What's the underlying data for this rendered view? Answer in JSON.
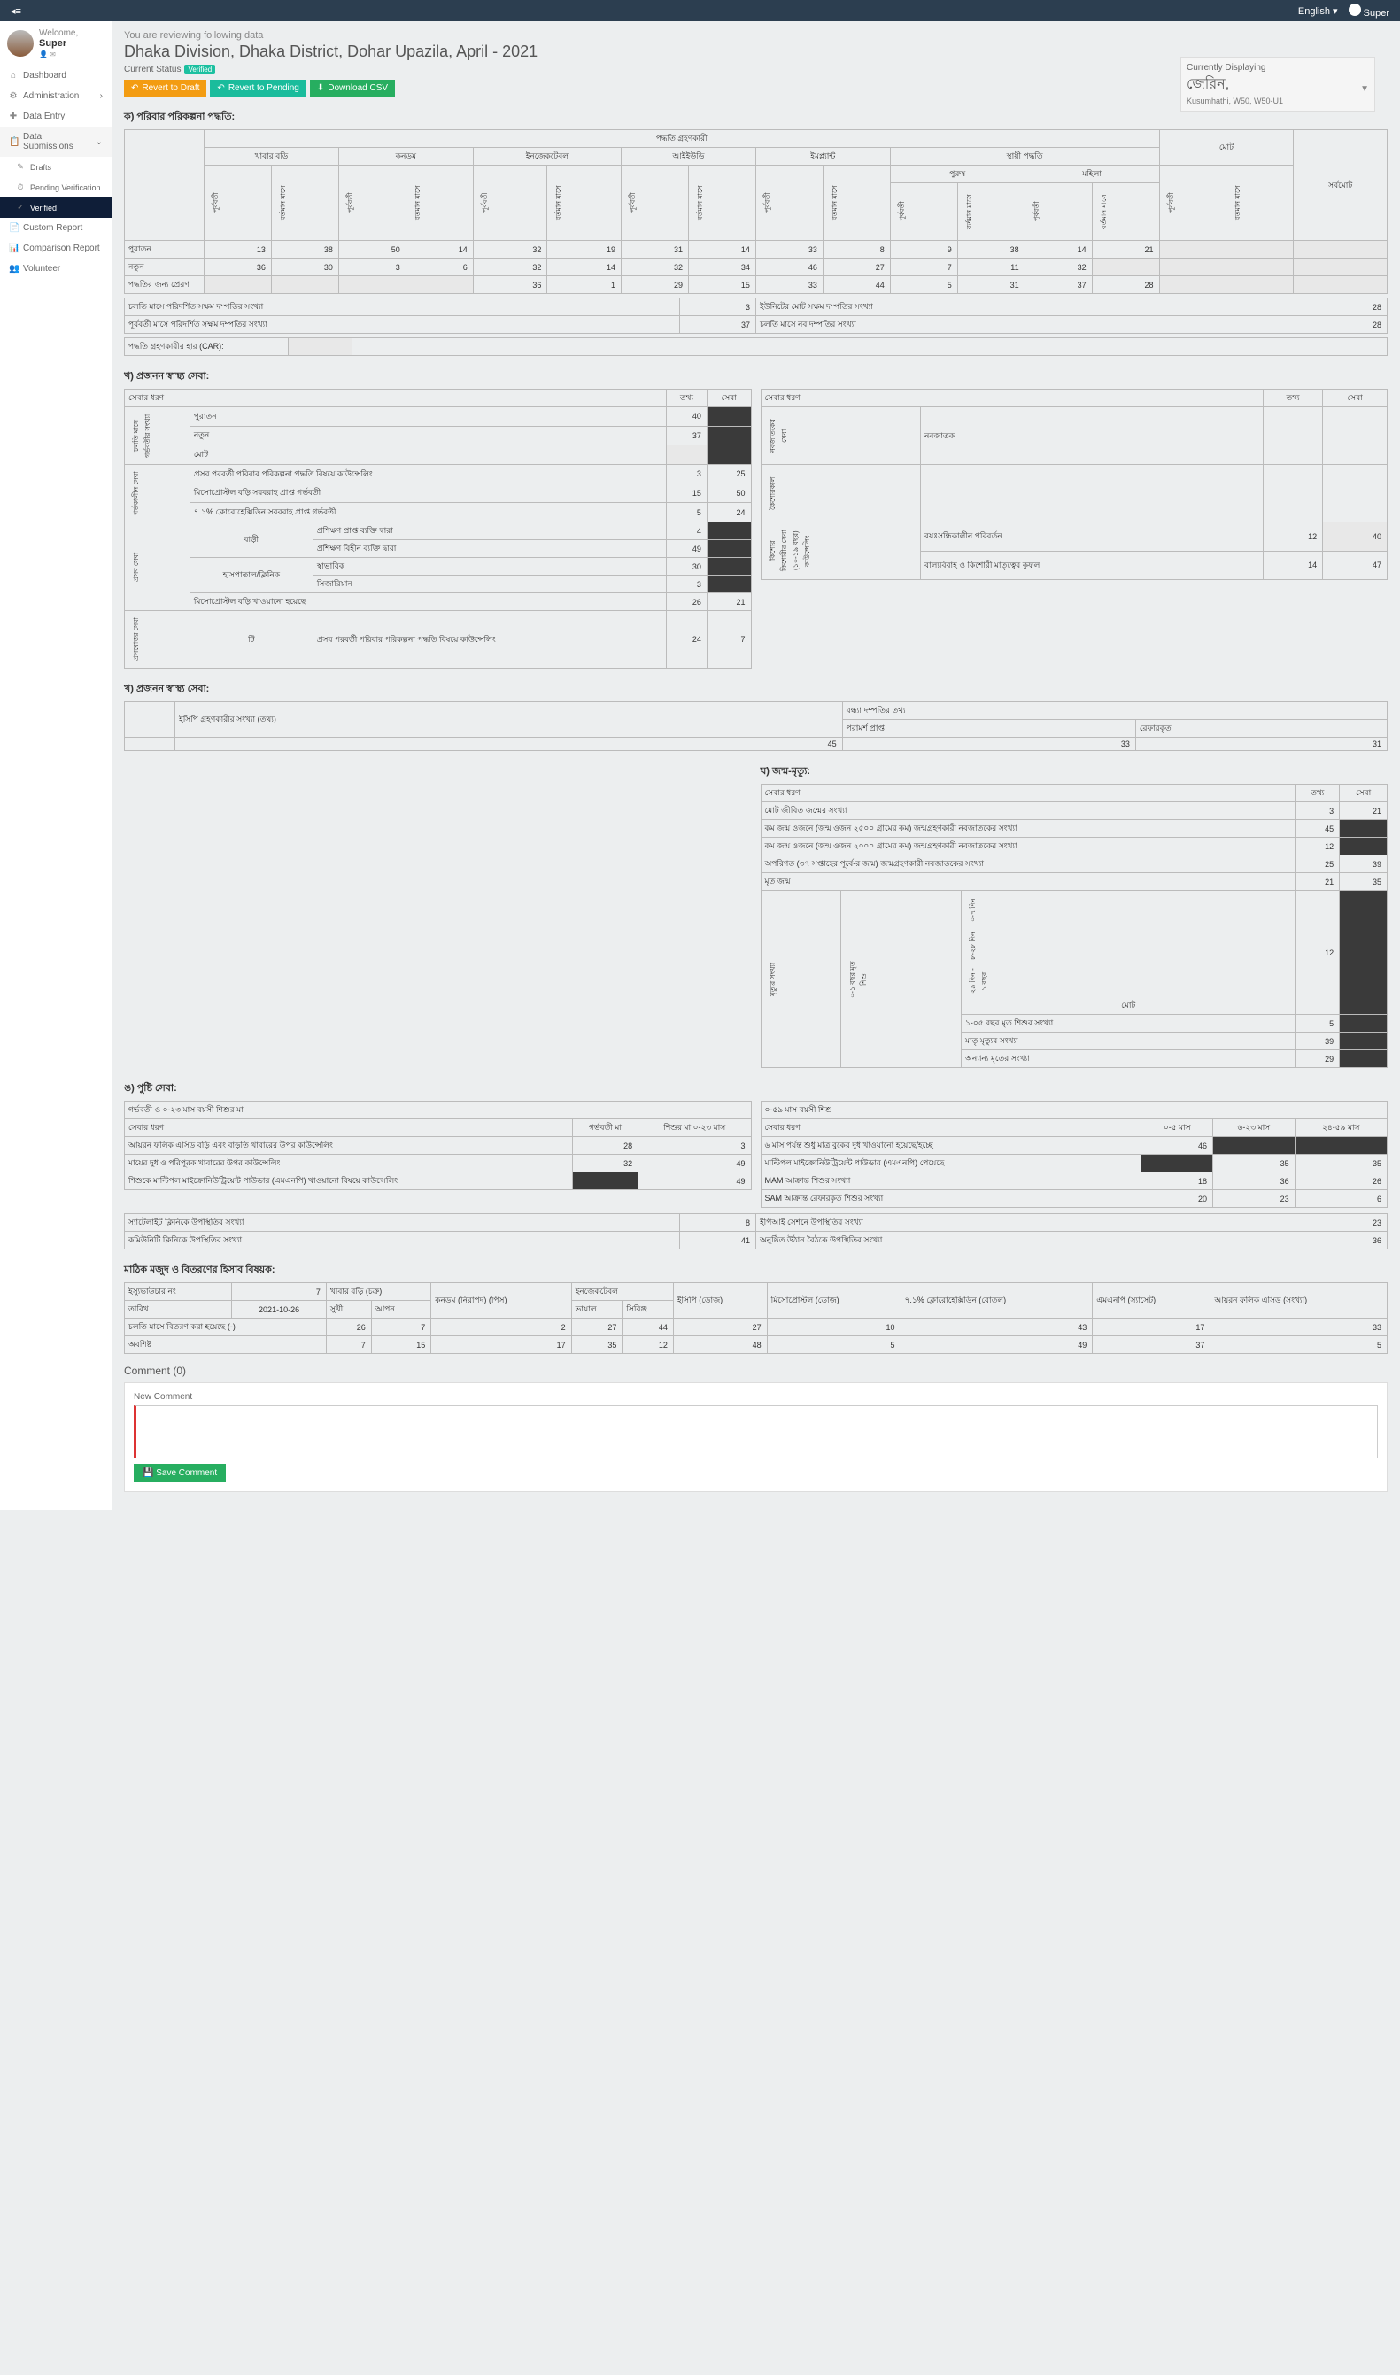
{
  "topbar": {
    "lang": "English",
    "user": "Super"
  },
  "user": {
    "welcome": "Welcome,",
    "name": "Super"
  },
  "nav": {
    "dashboard": "Dashboard",
    "admin": "Administration",
    "dataentry": "Data Entry",
    "datasub": "Data Submissions",
    "drafts": "Drafts",
    "pending": "Pending Verification",
    "verified": "Verified",
    "custom": "Custom Report",
    "compare": "Comparison Report",
    "volunteer": "Volunteer"
  },
  "head": {
    "review": "You are reviewing following data",
    "title": "Dhaka Division, Dhaka District, Dohar Upazila, April - 2021",
    "status_label": "Current Status",
    "status_badge": "Verified",
    "btn1": "Revert to Draft",
    "btn2": "Revert to Pending",
    "btn3": "Download CSV",
    "cd": "Currently Displaying",
    "cd_name": "জেরিন,",
    "cd_loc": "Kusumhathi, W50, W50-U1"
  },
  "secA": {
    "title": "ক) পরিবার পরিকল্পনা পদ্ধতি:",
    "top": "পদ্ধতি গ্রহণকারী",
    "h": {
      "pill": "খাবার বড়ি",
      "condom": "কনডম",
      "inj": "ইনজেকটেবল",
      "iud": "আইইউডি",
      "implant": "ইমপ্ল্যান্ট",
      "perm": "স্থায়ী পদ্ধতি",
      "male": "পুরুষ",
      "female": "মহিলা",
      "total": "মোট",
      "grand": "সর্বমোট",
      "prev": "পূর্ববর্তী",
      "curr": "বর্তমান মাসে",
      "left": "ছেড়ে দিয়ে..."
    },
    "rows": {
      "old": {
        "l": "পুরাতন",
        "v": [
          "13",
          "38",
          "50",
          "14",
          "32",
          "19",
          "31",
          "14",
          "33",
          "8",
          "9",
          "38",
          "14",
          "21",
          "",
          "",
          ""
        ]
      },
      "new": {
        "l": "নতুন",
        "v": [
          "36",
          "30",
          "3",
          "6",
          "32",
          "14",
          "32",
          "34",
          "46",
          "27",
          "7",
          "11",
          "32",
          "",
          "",
          ""
        ]
      },
      "send": {
        "l": "পদ্ধতির জন্য প্রেরণ",
        "v": [
          "",
          "",
          "",
          "",
          "36",
          "1",
          "29",
          "15",
          "33",
          "44",
          "5",
          "31",
          "37",
          "28",
          "",
          "",
          ""
        ]
      }
    },
    "foot": {
      "r1l": "চলতি মাসে পরিদর্শিত সক্ষম দম্পতির সংখ্যা",
      "r1v": "3",
      "r1l2": "ইউনিটের মোট সক্ষম দম্পতির সংখ্যা",
      "r1v2": "28",
      "r2l": "পূর্ববর্তী মাসে পরিদর্শিত সক্ষম দম্পতির সংখ্যা",
      "r2v": "37",
      "r2l2": "চলতি মাসে নব দম্পতির সংখ্যা",
      "r2v2": "28",
      "car": "পদ্ধতি গ্রহণকারীর হার (CAR):"
    }
  },
  "secB": {
    "title": "খ) প্রজনন স্বাস্থ্য সেবা:",
    "h": {
      "type": "সেবার ধরণ",
      "info": "তথ্য",
      "serv": "সেবা"
    },
    "left": {
      "group1": "চলতি মাসে গর্ভবতীর সংখ্যা",
      "old": "পুরাতন",
      "oldv": "40",
      "new": "নতুন",
      "newv": "37",
      "tot": "মোট",
      "group2": "গর্ভকালীন সেবা",
      "r1": "প্রসব পরবর্তী পরিবার পরিকল্পনা পদ্ধতি বিষয়ে কাউন্সেলিং",
      "r1a": "3",
      "r1b": "25",
      "r2": "মিসোপ্রোস্টল বড়ি সরবরাহ প্রাপ্ত গর্ভবতী",
      "r2a": "15",
      "r2b": "50",
      "r3": "৭.১% ক্লোরোহেক্সিডিন সরবরাহ প্রাপ্ত গর্ভবতী",
      "r3a": "5",
      "r3b": "24",
      "group3": "প্রসব সেবা",
      "home": "বাড়ী",
      "clinic": "হাসপাতাল/ক্লিনিক",
      "r4": "প্রশিক্ষণ প্রাপ্ত ব্যক্তি দ্বারা",
      "r4a": "4",
      "r5": "প্রশিক্ষণ বিহীন ব্যক্তি দ্বারা",
      "r5a": "49",
      "r6": "স্বাভাবিক",
      "r6a": "30",
      "r7": "সিজারিয়ান",
      "r7a": "3",
      "r8": "মিসোপ্রোস্টল বড়ি খাওয়ানো হয়েছে",
      "r8a": "26",
      "r8b": "21",
      "group4": "প্রসবোত্তর সেবা",
      "tick": "টি",
      "r9": "প্রসব পরবর্তী পরিবার পরিকল্পনা পদ্ধতি বিষয়ে কাউন্সেলিং",
      "r9a": "24",
      "r9b": "7"
    },
    "right": {
      "type": "সেবার ধরণ",
      "info": "তথ্য",
      "serv": "সেবা",
      "g1": "নবজাতকের সেবা",
      "g1r": "নবজাতক",
      "g2": "কৈশোরকাল",
      "g3": "কিশোর কিশোরীর সেবা (১০-১৯ বছর) কাউন্সেলিং",
      "r1": "বয়ঃসন্ধিকালীন পরিবর্তন",
      "r1a": "12",
      "r1b": "40",
      "r2": "বাল্যবিবাহ ও কিশোরী মাতৃত্বের কুফল",
      "r2a": "14",
      "r2b": "47"
    }
  },
  "secB2": {
    "title": "খ) প্রজনন স্বাস্থ্য সেবা:",
    "h1": "ইসিপি গ্রহণকারীর সংখ্যা (তথ্য)",
    "v1": "45",
    "h2": "বন্ধ্যা দম্পতির তথ্য",
    "h2a": "পরামর্শ প্রাপ্ত",
    "v2a": "33",
    "h2b": "রেফারকৃত",
    "v2b": "31"
  },
  "secC": {
    "title": "ঘ) জন্ম-মৃত্যু:",
    "h": {
      "type": "সেবার ধরণ",
      "info": "তথ্য",
      "serv": "সেবা"
    },
    "r1": "মোট জীবিত জন্মের সংখ্যা",
    "r1a": "3",
    "r1b": "21",
    "r2": "কম জন্ম ওজনে (জন্ম ওজন ২৫০০ গ্রামের কম) জন্মগ্রহণকারী নবজাতকের সংখ্যা",
    "r2a": "45",
    "r3": "কম জন্ম ওজনে (জন্ম ওজন ২০০০ গ্রামের কম) জন্মগ্রহণকারী নবজাতকের সংখ্যা",
    "r3a": "12",
    "r4": "অপরিণত (৩৭ সপ্তাহের পূর্বে-র জন্ম) জন্মগ্রহণকারী নবজাতকের সংখ্যা",
    "r4a": "25",
    "r4b": "39",
    "r5": "মৃত জন্ম",
    "r5a": "21",
    "r5b": "35",
    "g": "মৃত্যুর সংখ্যা",
    "gsub": "০-১ বছর মৃত শিশু",
    "gsub2": "০-৭ দিন",
    "gsub3": "৮-২৮ দিন",
    "gsub4": "২৯ দিন - ১ বছর",
    "gtot": "মোট",
    "gtotv": "12",
    "r6": "১-০৫ বছর মৃত শিশুর সংখ্যা",
    "r6a": "5",
    "r7": "মাতৃ মৃত্যুর সংখ্যা",
    "r7a": "39",
    "r8": "অন্যান্য মৃতের সংখ্যা",
    "r8a": "29"
  },
  "secD": {
    "title": "ঙ) পুষ্টি সেবা:",
    "left": {
      "h": "গর্ভবতী ও ০-২৩ মাস বয়সী শিশুর মা",
      "type": "সেবার ধরণ",
      "c1": "গর্ভবতী মা",
      "c2": "শিশুর মা ০-২৩ মাস",
      "r1": "আয়রন ফলিক এসিড বড়ি এবং বাড়তি খাবারের উপর কাউন্সেলিং",
      "r1a": "28",
      "r1b": "3",
      "r2": "মায়ের দুধ ও পরিপূরক খাবারের উপর কাউন্সেলিং",
      "r2a": "32",
      "r2b": "49",
      "r3": "শিশুকে মাল্টিপল মাইক্রোনিউট্রিয়েন্ট পাউডার (এমএনপি) খাওয়ানো বিষয়ে কাউন্সেলিং",
      "r3b": "49"
    },
    "right": {
      "h": "০-৫৯ মাস বয়সী শিশু",
      "type": "সেবার ধরণ",
      "c1": "০-৫ মাস",
      "c2": "৬-২৩ মাস",
      "c3": "২৪-৫৯ মাস",
      "r1": "৬ মাস পর্যন্ত শুধু মাত্র বুকের দুধ খাওয়ানো হয়েছে/হচ্ছে",
      "r1a": "46",
      "r2": "মাল্টিপল মাইক্রোনিউট্রিয়েন্ট পাউডার (এমএনপি) পেয়েছে",
      "r2b": "35",
      "r2c": "35",
      "r3": "MAM আক্রান্ত শিশুর সংখ্যা",
      "r3a": "18",
      "r3b": "36",
      "r3c": "26",
      "r4": "SAM আক্রান্ত রেফারকৃত শিশুর সংখ্যা",
      "r4a": "20",
      "r4b": "23",
      "r4c": "6"
    },
    "foot": {
      "r1l": "স্যাটেলাইট ক্লিনিকে উপস্থিতির সংখ্যা",
      "r1v": "8",
      "r1l2": "ইপিআই সেশনে উপস্থিতির সংখ্যা",
      "r1v2": "23",
      "r2l": "কমিউনিটি ক্লিনিকে উপস্থিতির সংখ্যা",
      "r2v": "41",
      "r2l2": "অনুষ্ঠিত উঠান বৈঠকে উপস্থিতির সংখ্যা",
      "r2v2": "36"
    }
  },
  "secE": {
    "title": "মাঠিক মজুদ ও বিতরণের হিসাব বিষয়ক:",
    "h": {
      "iss": "ইস্যুভাউচার নং",
      "date": "তারিখ",
      "pill": "খাবার বড়ি (চক্র)",
      "pill1": "সুখী",
      "pill2": "আপন",
      "condom": "কনডম (নিরাপদ) (পিস)",
      "inj": "ইনজেকটেবল",
      "inj1": "ভায়াল",
      "inj2": "সিরিঞ্জ",
      "ecp": "ইসিপি (ডোজ)",
      "miso": "মিসোপ্রোস্টল (ডোজ)",
      "chloro": "৭.১% ক্লোরোহেক্সিডিন (বোতল)",
      "mnp": "এমএনপি (স্যাসেট)",
      "ifa": "আয়রন ফলিক এসিড (সংখ্যা)"
    },
    "r1": {
      "iss": "7",
      "date": "2021-10-26"
    },
    "r2": {
      "l": "চলতি মাসে বিতরণ করা হয়েছে (-)",
      "v": [
        "26",
        "7",
        "2",
        "27",
        "44",
        "27",
        "10",
        "43",
        "17",
        "33"
      ]
    },
    "r3": {
      "l": "অবশিষ্ট",
      "v": [
        "7",
        "15",
        "17",
        "35",
        "12",
        "48",
        "5",
        "49",
        "37",
        "5"
      ]
    }
  },
  "comment": {
    "h": "Comment (0)",
    "new": "New Comment",
    "save": "Save Comment"
  }
}
